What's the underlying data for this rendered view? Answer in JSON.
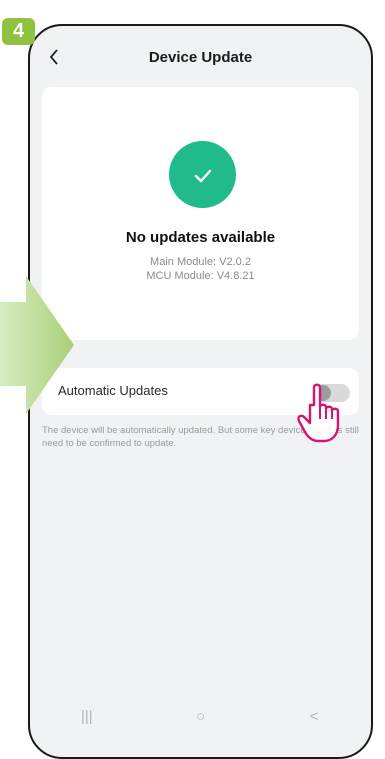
{
  "step": {
    "number": "4"
  },
  "header": {
    "title": "Device Update",
    "back_icon": "chevron-left-icon"
  },
  "status_card": {
    "icon": "check-circle-icon",
    "title": "No updates available",
    "main_module": "Main Module: V2.0.2",
    "mcu_module": "MCU Module: V4.8.21"
  },
  "auto_updates": {
    "label": "Automatic Updates",
    "toggle_on": false,
    "description": "The device will be automatically updated. But some key device features still need to be confirmed to update."
  },
  "nav": {
    "recent_label": "|||",
    "home_label": "○",
    "back_label": "<"
  },
  "colors": {
    "accent": "#21bb8b",
    "badge": "#8fc23f",
    "hand": "#d4156d",
    "arrow": "#b6d88a"
  }
}
